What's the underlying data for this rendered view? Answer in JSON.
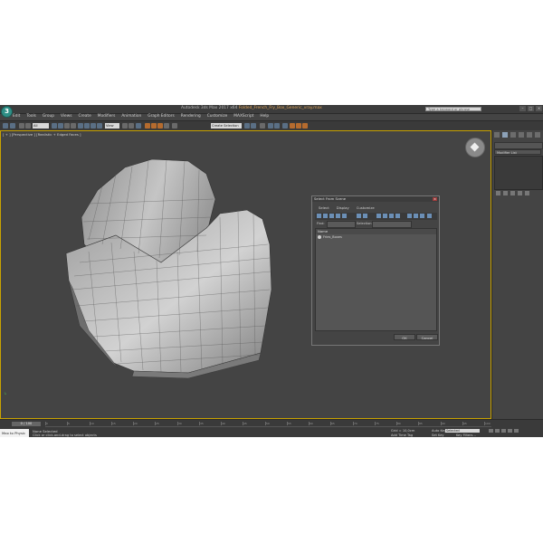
{
  "window": {
    "title_prefix": "Autodesk 3ds Max 2017 x64",
    "title_file": "Folded_French_Fry_Box_Generic_vray.max",
    "search_placeholder": "Type a keyword or phrase",
    "logo_text": "3"
  },
  "menu": [
    "Edit",
    "Tools",
    "Group",
    "Views",
    "Create",
    "Modifiers",
    "Animation",
    "Graph Editors",
    "Rendering",
    "Customize",
    "MAXScript",
    "Help"
  ],
  "toolbar": {
    "filter_value": "All",
    "view_value": "View",
    "named_selection": "Create Selection Se"
  },
  "viewport": {
    "label": "[ + ] [Perspective ] [Realistic + Edged Faces ]",
    "object_name": "Fries_Boxes"
  },
  "command_panel": {
    "modifier_list": "Modifier List"
  },
  "dialog": {
    "title": "Select From Scene",
    "close_icon": "×",
    "menu": [
      "Select",
      "Display",
      "Customize"
    ],
    "find_label": "Find:",
    "selection_sets_label": "Selection Set:",
    "column_header": "Name",
    "items": [
      {
        "name": "Fries_Boxes"
      }
    ],
    "ok_label": "OK",
    "cancel_label": "Cancel"
  },
  "timeline": {
    "frame_display": "0 / 100",
    "ruler_labels": [
      "0",
      "5",
      "10",
      "15",
      "20",
      "25",
      "30",
      "35",
      "40",
      "45",
      "50",
      "55",
      "60",
      "65",
      "70",
      "75",
      "80",
      "85",
      "90",
      "95",
      "100"
    ]
  },
  "status": {
    "maxscript_label": "Max to Physic",
    "selection_text": "None Selected",
    "hint_text": "Click or click-and-drag to select objects",
    "grid_text": "Grid = 10,0cm",
    "add_time_tag": "Add Time Tag",
    "auto_key": "Auto Key",
    "set_key": "Set Key",
    "selected_dropdown": "Selected",
    "key_filters": "Key Filters..."
  },
  "colors": {
    "viewport_border": "#c8a200",
    "app_bg": "#444444",
    "title_file_color": "#e0a65b"
  }
}
